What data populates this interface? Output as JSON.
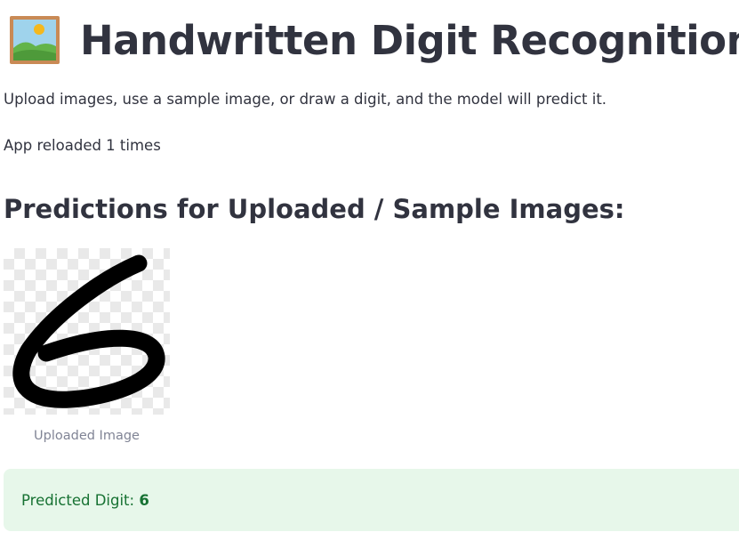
{
  "header": {
    "icon": "framed-picture-icon",
    "title": "Handwritten Digit Recognition"
  },
  "description": "Upload images, use a sample image, or draw a digit, and the model will predict it.",
  "reload_status": "App reloaded 1 times",
  "predictions": {
    "subheader": "Predictions for Uploaded / Sample Images:",
    "image_caption": "Uploaded Image",
    "result_label": "Predicted Digit:",
    "result_value": "6"
  },
  "colors": {
    "text": "#31333f",
    "caption": "#808495",
    "success_bg": "#e7f7ea",
    "success_text": "#177233"
  }
}
